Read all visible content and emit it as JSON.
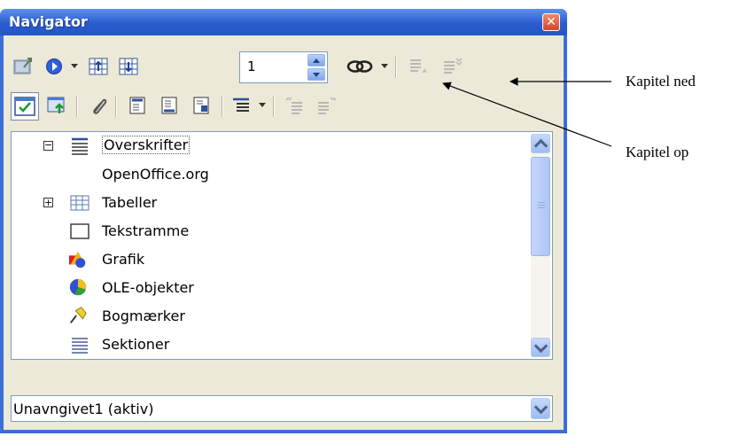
{
  "window": {
    "title": "Navigator",
    "close_glyph": "✕"
  },
  "toolbar": {
    "chapter_spin_value": "1",
    "icons_row1": [
      "toggle-icon",
      "navigation-icon",
      "previous-object-icon",
      "next-object-icon",
      "drag-mode-link-icon",
      "promote-level-icon",
      "demote-chapter-icon"
    ],
    "icons_row2": [
      "content-view-icon",
      "master-view-icon",
      "reminder-icon",
      "header-icon",
      "footer-icon",
      "anchor-icon",
      "heading-levels-icon",
      "promote-chapter-icon",
      "demote-level-icon"
    ]
  },
  "tree": {
    "items": [
      {
        "label": "Overskrifter",
        "icon": "headings-icon",
        "expander": "−",
        "selected": true
      },
      {
        "label": "OpenOffice.org",
        "icon": "",
        "expander": "",
        "selected": false
      },
      {
        "label": "Tabeller",
        "icon": "table-icon",
        "expander": "+",
        "selected": false
      },
      {
        "label": "Tekstramme",
        "icon": "text-frame-icon",
        "expander": "",
        "selected": false
      },
      {
        "label": "Grafik",
        "icon": "graphics-icon",
        "expander": "",
        "selected": false
      },
      {
        "label": "OLE-objekter",
        "icon": "ole-object-icon",
        "expander": "",
        "selected": false
      },
      {
        "label": "Bogmærker",
        "icon": "bookmark-icon",
        "expander": "",
        "selected": false
      },
      {
        "label": "Sektioner",
        "icon": "sections-icon",
        "expander": "",
        "selected": false
      }
    ]
  },
  "document_combo": {
    "value": "Unavngivet1 (aktiv)"
  },
  "annotations": {
    "chapter_down": "Kapitel ned",
    "chapter_up": "Kapitel op"
  },
  "colors": {
    "title_bar": "#2a5ccf",
    "client_bg": "#ece9d8",
    "close_button": "#d4462a",
    "scroll_blue": "#9cbcf2"
  }
}
